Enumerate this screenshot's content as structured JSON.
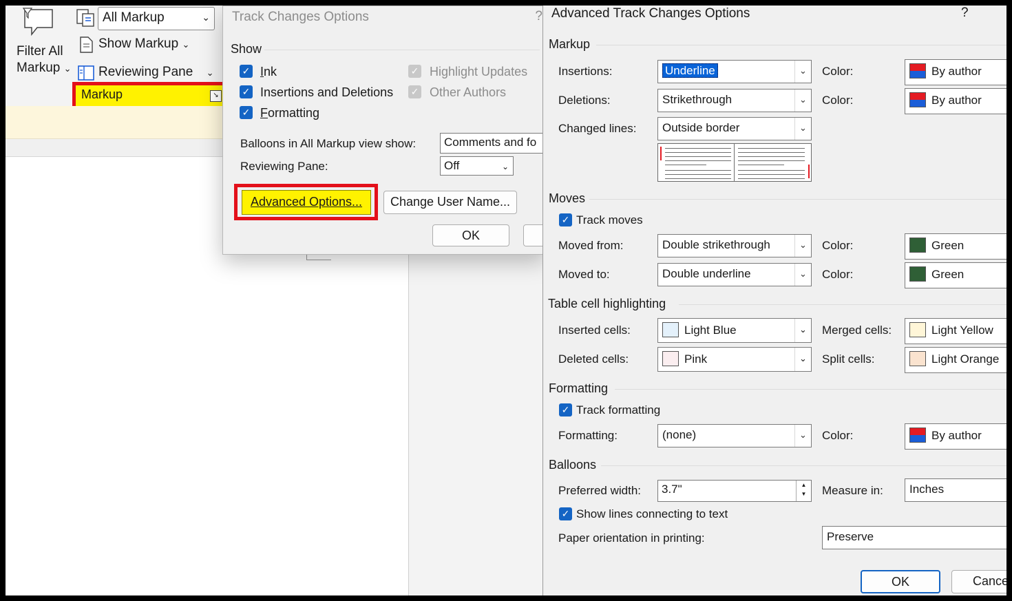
{
  "ribbon": {
    "filter_label_1": "Filter All",
    "filter_label_2": "Markup",
    "display_combo": "All Markup",
    "show_markup": "Show Markup",
    "reviewing_pane": "Reviewing Pane",
    "markup_group": "Markup"
  },
  "track_changes_dialog": {
    "title": "Track Changes Options",
    "help": "?",
    "show_section": "Show",
    "checkboxes": [
      {
        "label": "Ink",
        "checked": true,
        "enabled": true
      },
      {
        "label": "Insertions and Deletions",
        "checked": true,
        "enabled": true
      },
      {
        "label": "Formatting",
        "checked": true,
        "enabled": true
      },
      {
        "label": "Highlight Updates",
        "checked": true,
        "enabled": false
      },
      {
        "label": "Other Authors",
        "checked": true,
        "enabled": false
      }
    ],
    "balloons_label": "Balloons in All Markup view show:",
    "balloons_value": "Comments and fo",
    "reviewing_pane_label": "Reviewing Pane:",
    "reviewing_pane_value": "Off",
    "advanced_button": "Advanced Options...",
    "change_user_button": "Change User Name...",
    "ok_button": "OK"
  },
  "advanced_dialog": {
    "title": "Advanced Track Changes Options",
    "help": "?",
    "markup": {
      "section": "Markup",
      "insertions_label": "Insertions:",
      "insertions_value": "Underline",
      "deletions_label": "Deletions:",
      "deletions_value": "Strikethrough",
      "changed_lines_label": "Changed lines:",
      "changed_lines_value": "Outside border",
      "color_label": "Color:",
      "insertions_color": "By author",
      "deletions_color": "By author"
    },
    "moves": {
      "section": "Moves",
      "track_moves": "Track moves",
      "moved_from_label": "Moved from:",
      "moved_from_value": "Double strikethrough",
      "moved_to_label": "Moved to:",
      "moved_to_value": "Double underline",
      "color_label": "Color:",
      "moved_from_color": "Green",
      "moved_to_color": "Green"
    },
    "table": {
      "section": "Table cell highlighting",
      "inserted_label": "Inserted cells:",
      "inserted_value": "Light Blue",
      "deleted_label": "Deleted cells:",
      "deleted_value": "Pink",
      "merged_label": "Merged cells:",
      "merged_value": "Light Yellow",
      "split_label": "Split cells:",
      "split_value": "Light Orange"
    },
    "formatting": {
      "section": "Formatting",
      "track_formatting": "Track formatting",
      "formatting_label": "Formatting:",
      "formatting_value": "(none)",
      "color_label": "Color:",
      "color_value": "By author"
    },
    "balloons": {
      "section": "Balloons",
      "width_label": "Preferred width:",
      "width_value": "3.7\"",
      "measure_label": "Measure in:",
      "measure_value": "Inches",
      "show_lines": "Show lines connecting to text",
      "orientation_label": "Paper orientation in printing:",
      "orientation_value": "Preserve"
    },
    "ok_button": "OK",
    "cancel_button": "Cancel"
  },
  "colors": {
    "highlight_yellow": "#fff200",
    "highlight_red": "#e3101a",
    "checkbox_blue": "#1464c4",
    "selection_blue": "#0a64d8"
  }
}
